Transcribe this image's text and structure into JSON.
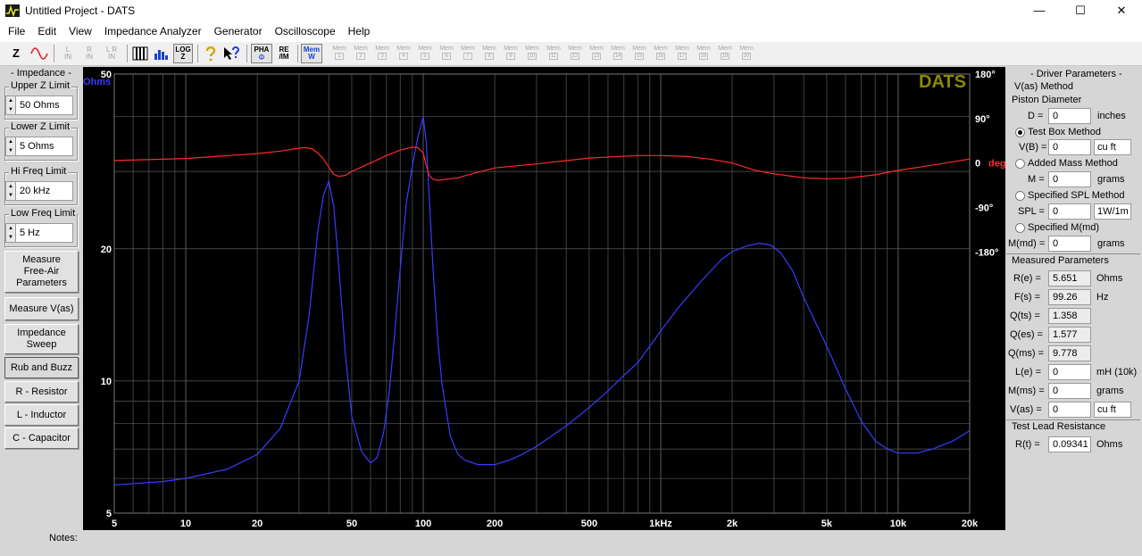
{
  "window": {
    "title": "Untitled Project - DATS",
    "minimize": "—",
    "maximize": "☐",
    "close": "✕"
  },
  "menu": [
    "File",
    "Edit",
    "View",
    "Impedance Analyzer",
    "Generator",
    "Oscilloscope",
    "Help"
  ],
  "toolbar": {
    "z_label": "Z",
    "left_in": "L\nIN",
    "right_in": "R\nIN",
    "lr_in": "L R\nIN",
    "log_z": "LOG\nZ",
    "pha": "PHA",
    "re_im": "RE\n/IM",
    "mem_w": "Mem\nW",
    "mem_label": "Mem",
    "mem_numbers": [
      "1",
      "2",
      "3",
      "4",
      "5",
      "6",
      "7",
      "8",
      "9",
      "10",
      "11",
      "12",
      "13",
      "14",
      "15",
      "16",
      "17",
      "18",
      "19",
      "20"
    ]
  },
  "left_panel": {
    "impedance_title": "- Impedance -",
    "upper_z_label": "Upper Z Limit",
    "upper_z_value": "50 Ohms",
    "lower_z_label": "Lower Z Limit",
    "lower_z_value": "5 Ohms",
    "hi_freq_label": "Hi Freq Limit",
    "hi_freq_value": "20 kHz",
    "low_freq_label": "Low Freq Limit",
    "low_freq_value": "5 Hz",
    "buttons": {
      "measure_free_air": "Measure\nFree-Air\nParameters",
      "measure_vas": "Measure V(as)",
      "impedance_sweep": "Impedance\nSweep",
      "rub_and_buzz": "Rub and Buzz",
      "r_resistor": "R - Resistor",
      "l_inductor": "L - Inductor",
      "c_capacitor": "C - Capacitor"
    }
  },
  "chart_data": {
    "type": "line",
    "brand": "DATS",
    "y_unit_label": "Ohms",
    "phase_unit_label": "deg",
    "x_scale": "log",
    "y_scale": "log",
    "xlim": [
      5,
      20000
    ],
    "ylim": [
      5,
      50
    ],
    "phase_lim": [
      -180,
      180
    ],
    "x_ticks": [
      5,
      10,
      20,
      50,
      100,
      200,
      500,
      1000,
      2000,
      5000,
      10000,
      20000
    ],
    "x_tick_labels": [
      "5",
      "10",
      "20",
      "50",
      "100",
      "200",
      "500",
      "1kHz",
      "2k",
      "5k",
      "10k",
      "20k"
    ],
    "y_ticks": [
      50,
      20,
      10,
      5
    ],
    "y_tick_labels": [
      "50",
      "20",
      "10",
      "5"
    ],
    "phase_ticks": [
      180,
      90,
      0,
      -90,
      -180
    ],
    "phase_tick_labels": [
      "180°",
      "90°",
      "0",
      "-90°",
      "-180°"
    ],
    "grid": true,
    "colors": {
      "background": "#000000",
      "grid": "#5a5a5a",
      "impedance": "#3b3bff",
      "phase": "#ff2a2a",
      "brand": "#8a8a00",
      "ohms_label": "#3b3bff",
      "phase_label": "#ff3030"
    },
    "series": [
      {
        "name": "Ohms",
        "axis": "left",
        "x": [
          5,
          8,
          10,
          15,
          20,
          25,
          30,
          33,
          36,
          38,
          40,
          42,
          44,
          47,
          50,
          55,
          60,
          64,
          68,
          72,
          76,
          80,
          85,
          90,
          95,
          100,
          103,
          106,
          110,
          115,
          120,
          130,
          140,
          150,
          170,
          200,
          230,
          260,
          300,
          400,
          500,
          600,
          700,
          800,
          900,
          1000,
          1200,
          1500,
          1800,
          2000,
          2300,
          2600,
          2900,
          3200,
          3600,
          4000,
          5000,
          6000,
          7000,
          8000,
          9000,
          10000,
          12000,
          14000,
          17000,
          20000
        ],
        "y": [
          5.8,
          5.9,
          6.0,
          6.3,
          6.8,
          7.8,
          10.0,
          14.0,
          22.0,
          26.5,
          28.5,
          25.0,
          18.5,
          11.5,
          8.3,
          6.9,
          6.5,
          6.7,
          7.6,
          9.5,
          13.0,
          18.0,
          25.5,
          31.0,
          36.0,
          40.0,
          35.0,
          26.0,
          18.0,
          12.5,
          9.8,
          7.5,
          6.8,
          6.6,
          6.45,
          6.45,
          6.6,
          6.8,
          7.1,
          7.9,
          8.7,
          9.5,
          10.3,
          11.0,
          12.0,
          13.0,
          14.8,
          17.0,
          18.9,
          19.7,
          20.3,
          20.6,
          20.4,
          19.6,
          17.8,
          15.5,
          12.0,
          9.6,
          8.1,
          7.3,
          7.0,
          6.85,
          6.85,
          7.0,
          7.3,
          7.7
        ]
      },
      {
        "name": "deg",
        "axis": "right",
        "x": [
          5,
          10,
          20,
          25,
          30,
          32,
          34,
          36,
          38,
          40,
          42,
          44,
          47,
          50,
          55,
          60,
          70,
          80,
          90,
          95,
          100,
          103,
          106,
          110,
          115,
          120,
          140,
          160,
          200,
          300,
          500,
          800,
          1000,
          1300,
          1600,
          2000,
          2500,
          3000,
          4000,
          5000,
          6000,
          8000,
          10000,
          15000,
          20000
        ],
        "y": [
          5,
          9,
          19,
          24,
          30,
          31,
          29,
          20,
          8,
          -8,
          -23,
          -27,
          -25,
          -17,
          -8,
          0,
          15,
          26,
          32,
          31,
          20,
          -5,
          -25,
          -33,
          -35,
          -34,
          -30,
          -22,
          -10,
          -2,
          10,
          15,
          15,
          13,
          8,
          0,
          -15,
          -22,
          -30,
          -32,
          -31,
          -24,
          -15,
          -2,
          8
        ]
      }
    ]
  },
  "right_panel": {
    "title": "- Driver Parameters -",
    "vas_method": "V(as) Method",
    "piston_diameter": "Piston Diameter",
    "d_label": "D =",
    "d_value": "0",
    "d_unit": "inches",
    "test_box_method": "Test Box Method",
    "vb_label": "V(B) =",
    "vb_value": "0",
    "vb_unit": "cu ft",
    "added_mass_method": "Added Mass Method",
    "m_label": "M =",
    "m_value": "0",
    "m_unit": "grams",
    "specified_spl_method": "Specified SPL Method",
    "spl_label": "SPL =",
    "spl_value": "0",
    "spl_unit": "1W/1m",
    "specified_mmd": "Specified M(md)",
    "mmd_label": "M(md) =",
    "mmd_value": "0",
    "mmd_unit": "grams",
    "measured_parameters": "Measured Parameters",
    "re_label": "R(e) =",
    "re_value": "5.651",
    "re_unit": "Ohms",
    "fs_label": "F(s) =",
    "fs_value": "99.26",
    "fs_unit": "Hz",
    "qts_label": "Q(ts) =",
    "qts_value": "1.358",
    "qes_label": "Q(es) =",
    "qes_value": "1.577",
    "qms_label": "Q(ms) =",
    "qms_value": "9.778",
    "le_label": "L(e) =",
    "le_value": "0",
    "le_unit": "mH (10k)",
    "mms_label": "M(ms) =",
    "mms_value": "0",
    "mms_unit": "grams",
    "vas_label": "V(as) =",
    "vas_value": "0",
    "vas_unit": "cu ft",
    "test_lead_resistance": "Test Lead Resistance",
    "rt_label": "R(t) =",
    "rt_value": "0.09341",
    "rt_unit": "Ohms"
  },
  "notes_label": "Notes:"
}
